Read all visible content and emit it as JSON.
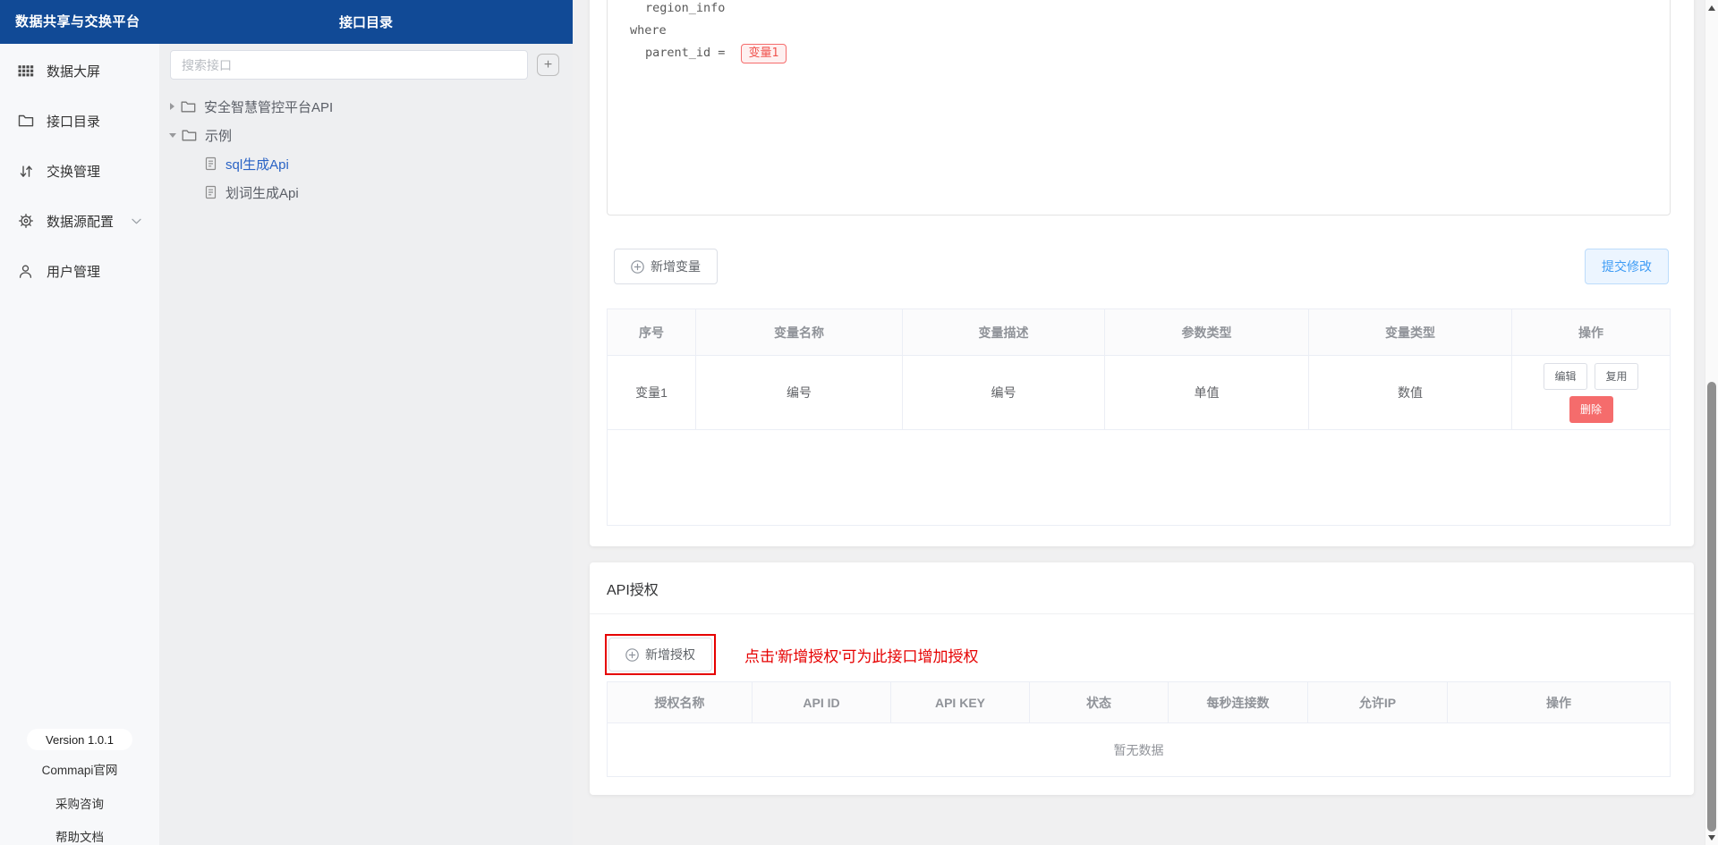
{
  "header": {
    "app_title": "数据共享与交换平台",
    "panel_title": "接口目录"
  },
  "sidebar": {
    "items": [
      {
        "label": "数据大屏",
        "icon": "grid-icon"
      },
      {
        "label": "接口目录",
        "icon": "folder-icon"
      },
      {
        "label": "交换管理",
        "icon": "swap-icon"
      },
      {
        "label": "数据源配置",
        "icon": "gear-icon",
        "has_submenu": true
      },
      {
        "label": "用户管理",
        "icon": "user-icon"
      }
    ],
    "footer": {
      "version": "Version 1.0.1",
      "links": [
        "Commapi官网",
        "采购咨询",
        "帮助文档"
      ]
    }
  },
  "catalog": {
    "search_placeholder": "搜索接口",
    "add_button_label": "+",
    "tree": [
      {
        "label": "安全智慧管控平台API",
        "type": "folder",
        "state": "collapsed"
      },
      {
        "label": "示例",
        "type": "folder",
        "state": "expanded"
      },
      {
        "label": "sql生成Api",
        "type": "file",
        "selected": true
      },
      {
        "label": "划词生成Api",
        "type": "file",
        "selected": false
      }
    ]
  },
  "editor": {
    "line1": "region_info",
    "line2": "where",
    "line3": "parent_id = ",
    "variable_chip": "变量1"
  },
  "toolbar": {
    "add_variable": "新增变量",
    "submit": "提交修改"
  },
  "variables_table": {
    "headers": [
      "序号",
      "变量名称",
      "变量描述",
      "参数类型",
      "变量类型",
      "操作"
    ],
    "row": {
      "cells": [
        "变量1",
        "编号",
        "编号",
        "单值",
        "数值"
      ],
      "actions": {
        "edit": "编辑",
        "reuse": "复用",
        "delete": "删除"
      }
    }
  },
  "auth": {
    "title": "API授权",
    "add_button": "新增授权",
    "annotation": "点击'新增授权'可为此接口增加授权",
    "table": {
      "headers": [
        "授权名称",
        "API ID",
        "API KEY",
        "状态",
        "每秒连接数",
        "允许IP",
        "操作"
      ],
      "empty_text": "暂无数据"
    }
  },
  "colors": {
    "header_blue": "#114a96",
    "selected_link_blue": "#2a63c5",
    "danger_red": "#f56c6c",
    "annotation_red": "#e60000",
    "primary_blue": "#409eff"
  }
}
